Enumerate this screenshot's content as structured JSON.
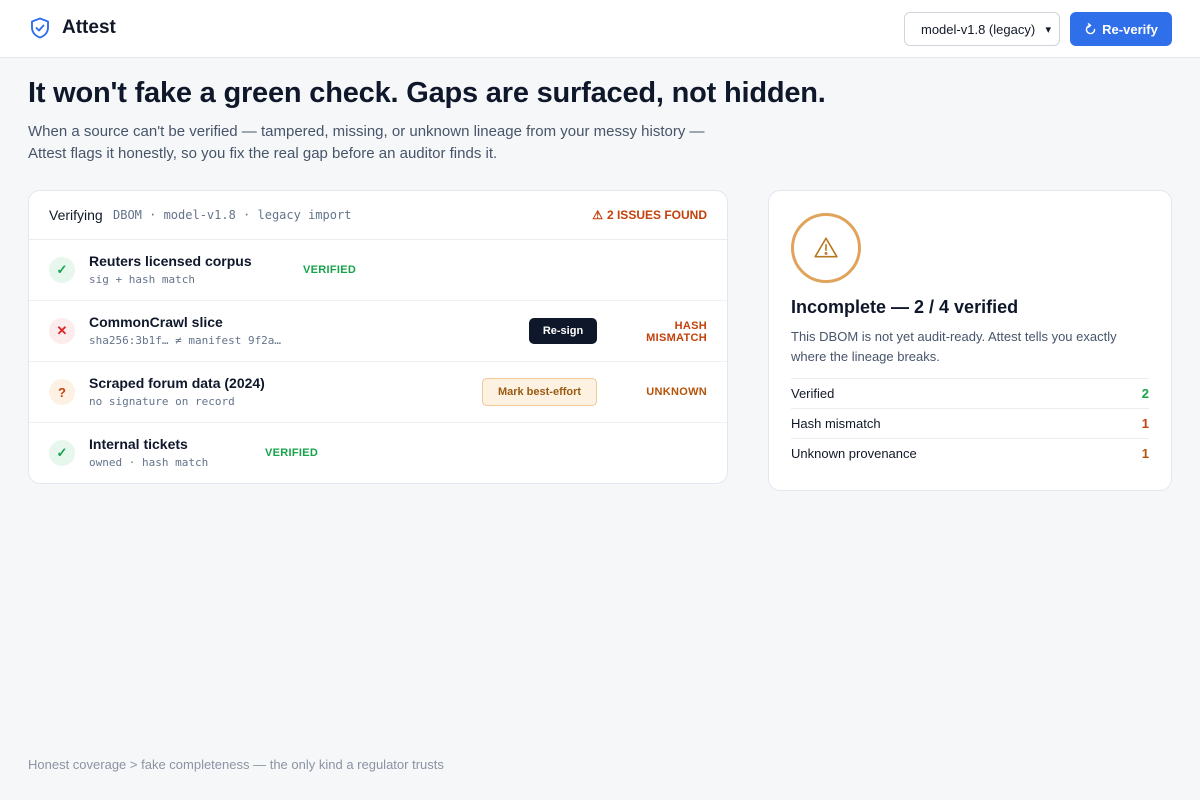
{
  "header": {
    "brand": "Attest",
    "brand_icon": "shield-check-icon",
    "version_selected": "model-v1.8 (legacy)",
    "reverify_label": "Re-verify",
    "accent_color": "#2f6fea"
  },
  "hero": {
    "title": "It won't fake a green check. Gaps are surfaced, not hidden.",
    "subtitle_line1": "When a source can't be verified — tampered, missing, or unknown lineage from your messy history —",
    "subtitle_line2": "Attest flags it honestly, so you fix the real gap before an auditor finds it."
  },
  "verify": {
    "label": "Verifying",
    "path": "DBOM · model-v1.8 · legacy import",
    "issues": "2 ISSUES FOUND",
    "rows": [
      {
        "name": "Reuters licensed corpus",
        "detail": "sig + hash match",
        "status": "VERIFIED",
        "icon": "check-icon"
      },
      {
        "name": "CommonCrawl slice",
        "detail": "sha256:3b1f… ≠ manifest 9f2a…",
        "status_line1": "HASH",
        "status_line2": "MISMATCH",
        "action": "Re-sign",
        "icon": "x-icon"
      },
      {
        "name": "Scraped forum data (2024)",
        "detail": "no signature on record",
        "status": "UNKNOWN",
        "action": "Mark best-effort",
        "icon": "question-icon"
      },
      {
        "name": "Internal tickets",
        "detail": "owned · hash match",
        "status": "VERIFIED",
        "icon": "check-icon"
      }
    ]
  },
  "summary": {
    "title": "Incomplete — 2 / 4 verified",
    "description": "This DBOM is not yet audit-ready. Attest tells you exactly where the lineage breaks.",
    "items": [
      {
        "label": "Verified",
        "count": "2"
      },
      {
        "label": "Hash mismatch",
        "count": "1"
      },
      {
        "label": "Unknown provenance",
        "count": "1"
      }
    ]
  },
  "footer": "Honest coverage > fake completeness — the only kind a regulator trusts"
}
